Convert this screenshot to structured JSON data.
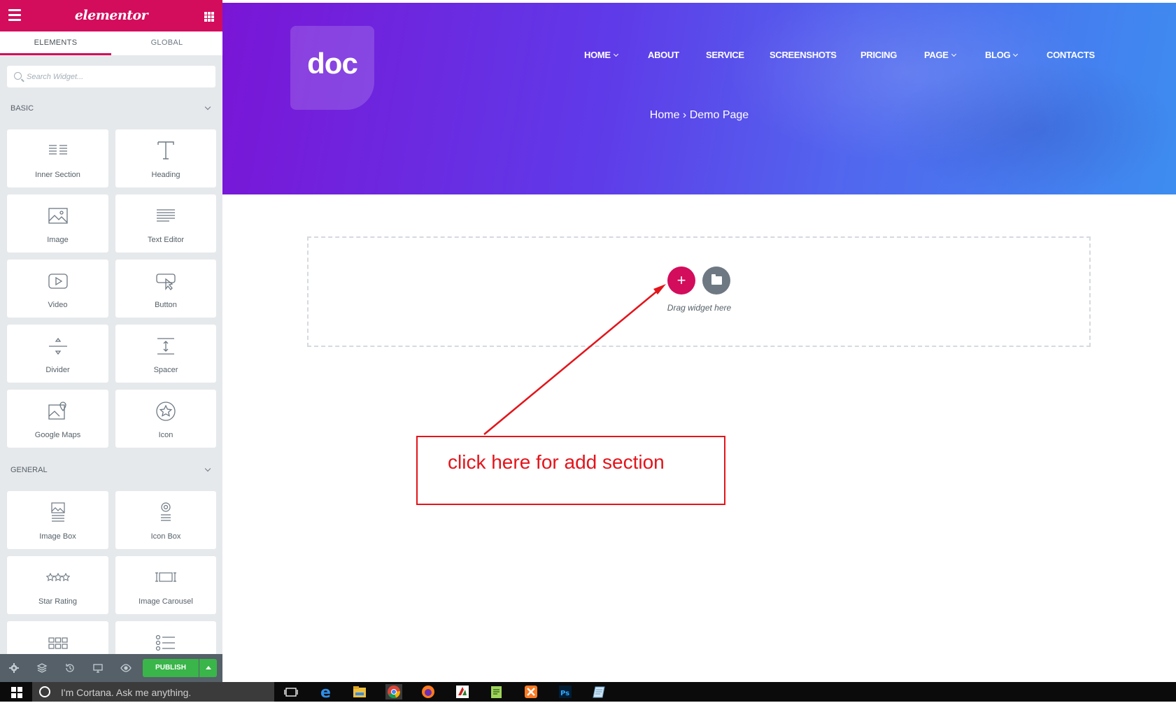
{
  "panel": {
    "logo": "elementor",
    "tabs": [
      {
        "label": "ELEMENTS"
      },
      {
        "label": "GLOBAL"
      }
    ],
    "search_placeholder": "Search Widget...",
    "categories": {
      "basic": {
        "title": "BASIC",
        "widgets": [
          {
            "label": "Inner Section",
            "icon": "inner-section-icon"
          },
          {
            "label": "Heading",
            "icon": "heading-icon"
          },
          {
            "label": "Image",
            "icon": "image-icon"
          },
          {
            "label": "Text Editor",
            "icon": "text-editor-icon"
          },
          {
            "label": "Video",
            "icon": "video-icon"
          },
          {
            "label": "Button",
            "icon": "button-icon"
          },
          {
            "label": "Divider",
            "icon": "divider-icon"
          },
          {
            "label": "Spacer",
            "icon": "spacer-icon"
          },
          {
            "label": "Google Maps",
            "icon": "google-maps-icon"
          },
          {
            "label": "Icon",
            "icon": "star-icon"
          }
        ]
      },
      "general": {
        "title": "GENERAL",
        "widgets": [
          {
            "label": "Image Box",
            "icon": "image-box-icon"
          },
          {
            "label": "Icon Box",
            "icon": "icon-box-icon"
          },
          {
            "label": "Star Rating",
            "icon": "star-rating-icon"
          },
          {
            "label": "Image Carousel",
            "icon": "image-carousel-icon"
          },
          {
            "label": "",
            "icon": "gallery-icon"
          },
          {
            "label": "",
            "icon": "icon-list-icon"
          }
        ]
      }
    },
    "footer": {
      "publish_label": "PUBLISH"
    },
    "colors": {
      "brand": "#d30c5c",
      "publish": "#39b54a"
    }
  },
  "preview": {
    "logo_text": "doc",
    "nav": [
      {
        "label": "HOME",
        "dropdown": true
      },
      {
        "label": "ABOUT",
        "dropdown": false
      },
      {
        "label": "SERVICE",
        "dropdown": false
      },
      {
        "label": "SCREENSHOTS",
        "dropdown": false
      },
      {
        "label": "PRICING",
        "dropdown": false
      },
      {
        "label": "PAGE",
        "dropdown": true
      },
      {
        "label": "BLOG",
        "dropdown": true
      },
      {
        "label": "CONTACTS",
        "dropdown": false
      }
    ],
    "breadcrumb": {
      "home": "Home",
      "separator": "›",
      "current": "Demo Page"
    },
    "drop_zone": {
      "add_symbol": "+",
      "hint": "Drag widget here"
    },
    "annotation": {
      "text": "click here for add section",
      "color": "#e3141b"
    }
  },
  "taskbar": {
    "cortana_placeholder": "I'm Cortana. Ask me anything.",
    "apps": [
      "task-view-icon",
      "edge-icon",
      "file-explorer-icon",
      "chrome-icon",
      "firefox-icon",
      "filezilla-icon",
      "notepad-plus-icon",
      "xampp-icon",
      "photoshop-icon",
      "notes-icon"
    ]
  }
}
